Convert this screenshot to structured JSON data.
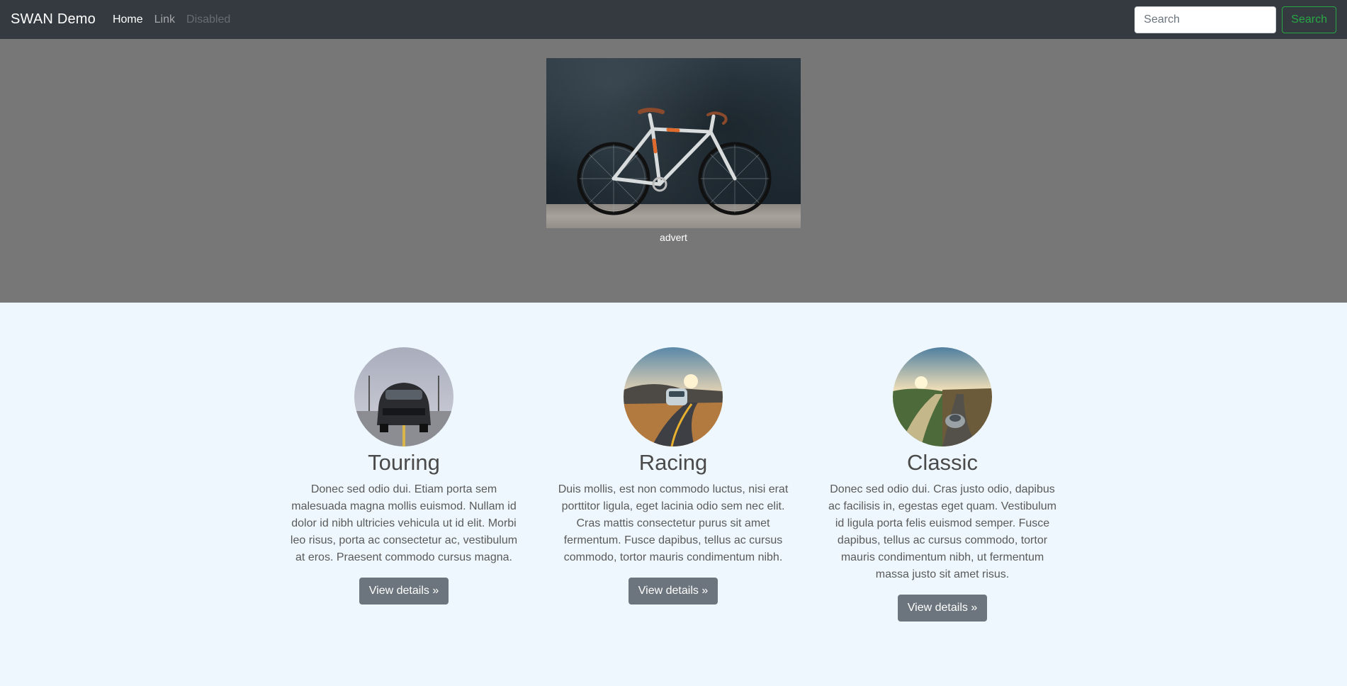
{
  "navbar": {
    "brand": "SWAN Demo",
    "links": [
      {
        "label": "Home",
        "state": "active"
      },
      {
        "label": "Link",
        "state": "normal"
      },
      {
        "label": "Disabled",
        "state": "disabled"
      }
    ],
    "search": {
      "placeholder": "Search",
      "value": ""
    },
    "search_button": "Search"
  },
  "hero": {
    "image_icon": "bicycle-image",
    "caption": "advert"
  },
  "features": [
    {
      "image_icon": "car-front-image",
      "title": "Touring",
      "text": "Donec sed odio dui. Etiam porta sem malesuada magna mollis euismod. Nullam id dolor id nibh ultricies vehicula ut id elit. Morbi leo risus, porta ac consectetur ac, vestibulum at eros. Praesent commodo cursus magna.",
      "button": "View details »"
    },
    {
      "image_icon": "road-car-image",
      "title": "Racing",
      "text": "Duis mollis, est non commodo luctus, nisi erat porttitor ligula, eget lacinia odio sem nec elit. Cras mattis consectetur purus sit amet fermentum. Fusce dapibus, tellus ac cursus commodo, tortor mauris condimentum nibh.",
      "button": "View details »"
    },
    {
      "image_icon": "classic-car-image",
      "title": "Classic",
      "text": "Donec sed odio dui. Cras justo odio, dapibus ac facilisis in, egestas eget quam. Vestibulum id ligula porta felis euismod semper. Fusce dapibus, tellus ac cursus commodo, tortor mauris condimentum nibh, ut fermentum massa justo sit amet risus.",
      "button": "View details »"
    }
  ],
  "colors": {
    "navbar_bg": "#343a40",
    "hero_bg": "#777777",
    "page_bg": "#eef7fd",
    "search_accent": "#28a745",
    "button_bg": "#6c757d"
  }
}
